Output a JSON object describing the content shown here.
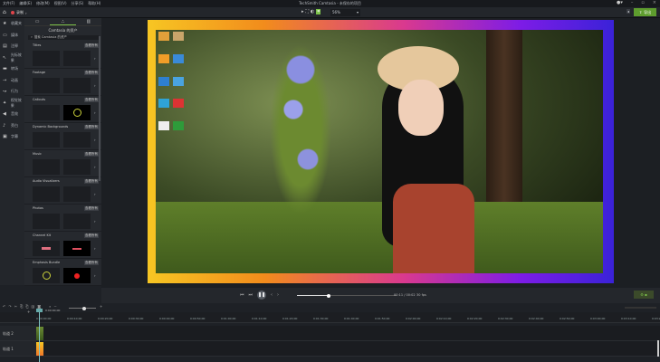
{
  "menu": [
    "文件(F)",
    "编辑(E)",
    "修改(M)",
    "视图(V)",
    "分享(S)",
    "帮助(H)"
  ],
  "title": "TechSmith Camtasia - 未保存的项目",
  "toolbar": {
    "record": "录制",
    "zoom": "56%",
    "export": "导出"
  },
  "nav": [
    {
      "icon": "star-icon",
      "label": "收藏夹"
    },
    {
      "icon": "media-icon",
      "label": "媒体"
    },
    {
      "icon": "annotation-icon",
      "label": "注释"
    },
    {
      "icon": "cursor-effect-icon",
      "label": "光标效果"
    },
    {
      "icon": "transition-icon",
      "label": "转场"
    },
    {
      "icon": "animation-icon",
      "label": "动画"
    },
    {
      "icon": "behavior-icon",
      "label": "行为"
    },
    {
      "icon": "visual-effect-icon",
      "label": "视觉效果"
    },
    {
      "icon": "audio-icon",
      "label": "音效"
    },
    {
      "icon": "mic-icon",
      "label": "旁白"
    },
    {
      "icon": "caption-icon",
      "label": "字幕"
    }
  ],
  "library": {
    "title": "Camtasia 的资产",
    "search": "搜索 Camtasia 的资产",
    "view_all": "查看所有",
    "sections": [
      "Titles",
      "Footage",
      "Callouts",
      "Dynamic Backgrounds",
      "Music",
      "Audio Visualizers",
      "Photos",
      "Channel Kit",
      "Emphasis Bundle"
    ]
  },
  "playback": {
    "time": "00:11 / 00:02",
    "fps": "30 fps",
    "progress": 0.32
  },
  "timeline": {
    "playhead": "0:00:00;00",
    "ticks": [
      "0:00:00;00",
      "0:00:10;00",
      "0:00:20;00",
      "0:00:30;00",
      "0:00:40;00",
      "0:00:50;00",
      "0:01:00;00",
      "0:01:10;00",
      "0:01:20;00",
      "0:01:30;00",
      "0:01:40;00",
      "0:01:50;00",
      "0:02:00;00",
      "0:02:10;00",
      "0:02:20;00",
      "0:02:30;00",
      "0:02:40;00",
      "0:02:50;00",
      "0:03:00;00",
      "0:03:10;00",
      "0:03:20;00"
    ],
    "tracks": [
      "轨道 2",
      "轨道 1"
    ]
  },
  "colors": {
    "accent": "#7cc24a"
  }
}
